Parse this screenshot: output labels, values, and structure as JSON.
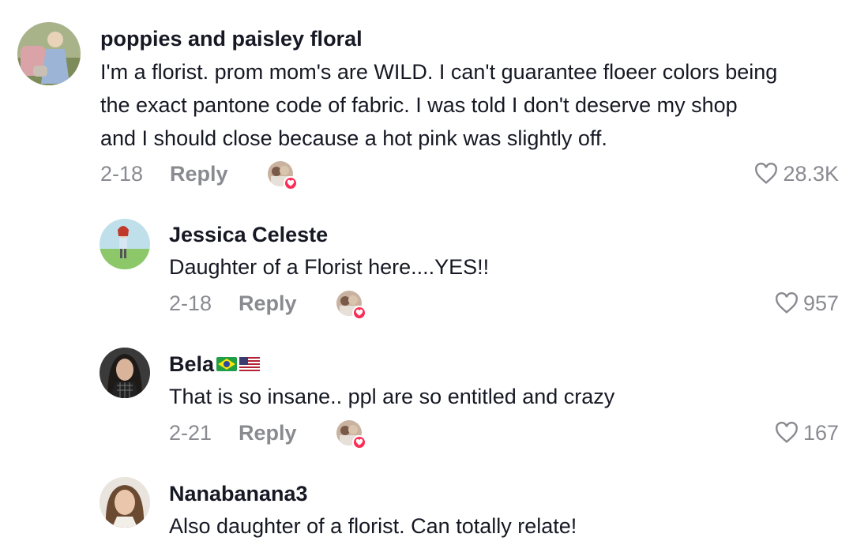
{
  "comments": [
    {
      "username": "poppies and paisley floral",
      "lines": [
        "I'm a florist. prom mom's are WILD. I can't guarantee floeer colors being",
        "the exact pantone code of fabric. I was told I don't deserve my shop",
        "and I should close because a hot pink was slightly off."
      ],
      "date": "2-18",
      "reply_label": "Reply",
      "likes": "28.3K"
    },
    {
      "username": "Jessica Celeste",
      "lines": [
        "Daughter of a Florist here....YES!!"
      ],
      "date": "2-18",
      "reply_label": "Reply",
      "likes": "957"
    },
    {
      "username": "Bela",
      "flags": [
        "brazil-flag-icon",
        "us-flag-icon"
      ],
      "lines": [
        "That is so insane.. ppl are so entitled and crazy"
      ],
      "date": "2-21",
      "reply_label": "Reply",
      "likes": "167"
    },
    {
      "username": "Nanabanana3",
      "lines": [
        "Also daughter of a florist. Can totally relate!"
      ]
    }
  ],
  "colors": {
    "text": "#161823",
    "muted": "#8a8b91",
    "heart_badge": "#fe2c55"
  }
}
